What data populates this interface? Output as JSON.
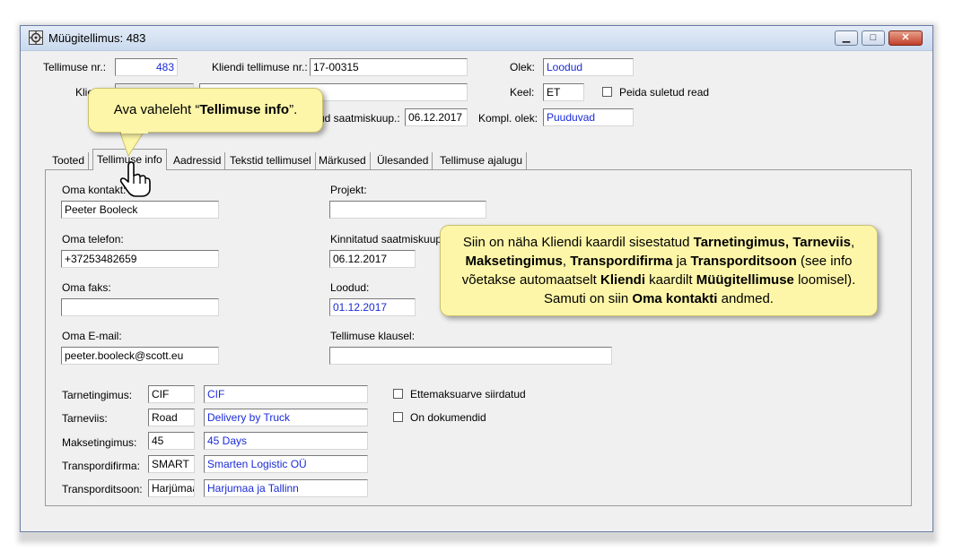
{
  "window": {
    "title": "Müügitellimus: 483"
  },
  "header": {
    "order_no_label": "Tellimuse nr.:",
    "order_no": "483",
    "client_order_label": "Kliendi tellimuse nr.:",
    "client_order": "17-00315",
    "status_label": "Olek:",
    "status": "Loodud",
    "client_label": "Klie",
    "language_label": "Keel:",
    "language": "ET",
    "hide_closed_label": "Peida suletud read",
    "delivery_date_label": "ud saatmiskuup.:",
    "delivery_date": "06.12.2017",
    "complete_status_label": "Kompl. olek:",
    "complete_status": "Puuduvad"
  },
  "tabs": [
    "Tooted",
    "Tellimuse info",
    "Aadressid",
    "Tekstid tellimusel",
    "Märkused",
    "Ülesanded",
    "Tellimuse ajalugu"
  ],
  "info": {
    "own_contact_label": "Oma kontakt:",
    "own_contact": "Peeter Booleck",
    "project_label": "Projekt:",
    "project": "",
    "own_phone_label": "Oma telefon:",
    "own_phone": "+37253482659",
    "confirmed_date_label": "Kinnitatud saatmiskuup.:",
    "confirmed_date": "06.12.2017",
    "own_fax_label": "Oma faks:",
    "own_fax": "",
    "created_label": "Loodud:",
    "created": "01.12.2017",
    "own_email_label": "Oma E-mail:",
    "own_email": "peeter.booleck@scott.eu",
    "clause_label": "Tellimuse klausel:",
    "clause": ""
  },
  "terms": {
    "delivery_terms_label": "Tarnetingimus:",
    "delivery_terms_code": "CIF",
    "delivery_terms_text": "CIF",
    "delivery_method_label": "Tarneviis:",
    "delivery_method_code": "Road",
    "delivery_method_text": "Delivery by Truck",
    "payment_terms_label": "Maksetingimus:",
    "payment_terms_code": "45",
    "payment_terms_text": "45 Days",
    "carrier_label": "Transpordifirma:",
    "carrier_code": "SMART",
    "carrier_text": "Smarten Logistic OÜ",
    "transport_zone_label": "Transporditsoon:",
    "transport_zone_code": "Harjümaa",
    "transport_zone_text": "Harjumaa ja Tallinn",
    "prepayment_label": "Ettemaksuarve siirdatud",
    "documents_label": "On dokumendid"
  },
  "callouts": {
    "tab_hint_pre": "Ava vaheleht “",
    "tab_hint_bold": "Tellimuse info",
    "tab_hint_post": "”.",
    "info_text": [
      {
        "t": "Siin on näha Kliendi kaardil sisestatud ",
        "b": false
      },
      {
        "t": "Tarnetingimus, Tarneviis",
        "b": true
      },
      {
        "t": ", ",
        "b": false
      },
      {
        "t": "Maksetingimus",
        "b": true
      },
      {
        "t": ", ",
        "b": false
      },
      {
        "t": "Transpordifirma",
        "b": true
      },
      {
        "t": " ja ",
        "b": false
      },
      {
        "t": "Transporditsoon",
        "b": true
      },
      {
        "t": " (see info võetakse automaatselt ",
        "b": false
      },
      {
        "t": "Kliendi",
        "b": true
      },
      {
        "t": " kaardilt ",
        "b": false
      },
      {
        "t": "Müügitellimuse",
        "b": true
      },
      {
        "t": " loomisel).  Samuti on siin ",
        "b": false
      },
      {
        "t": "Oma kontakti",
        "b": true
      },
      {
        "t": " andmed.",
        "b": false
      }
    ]
  }
}
